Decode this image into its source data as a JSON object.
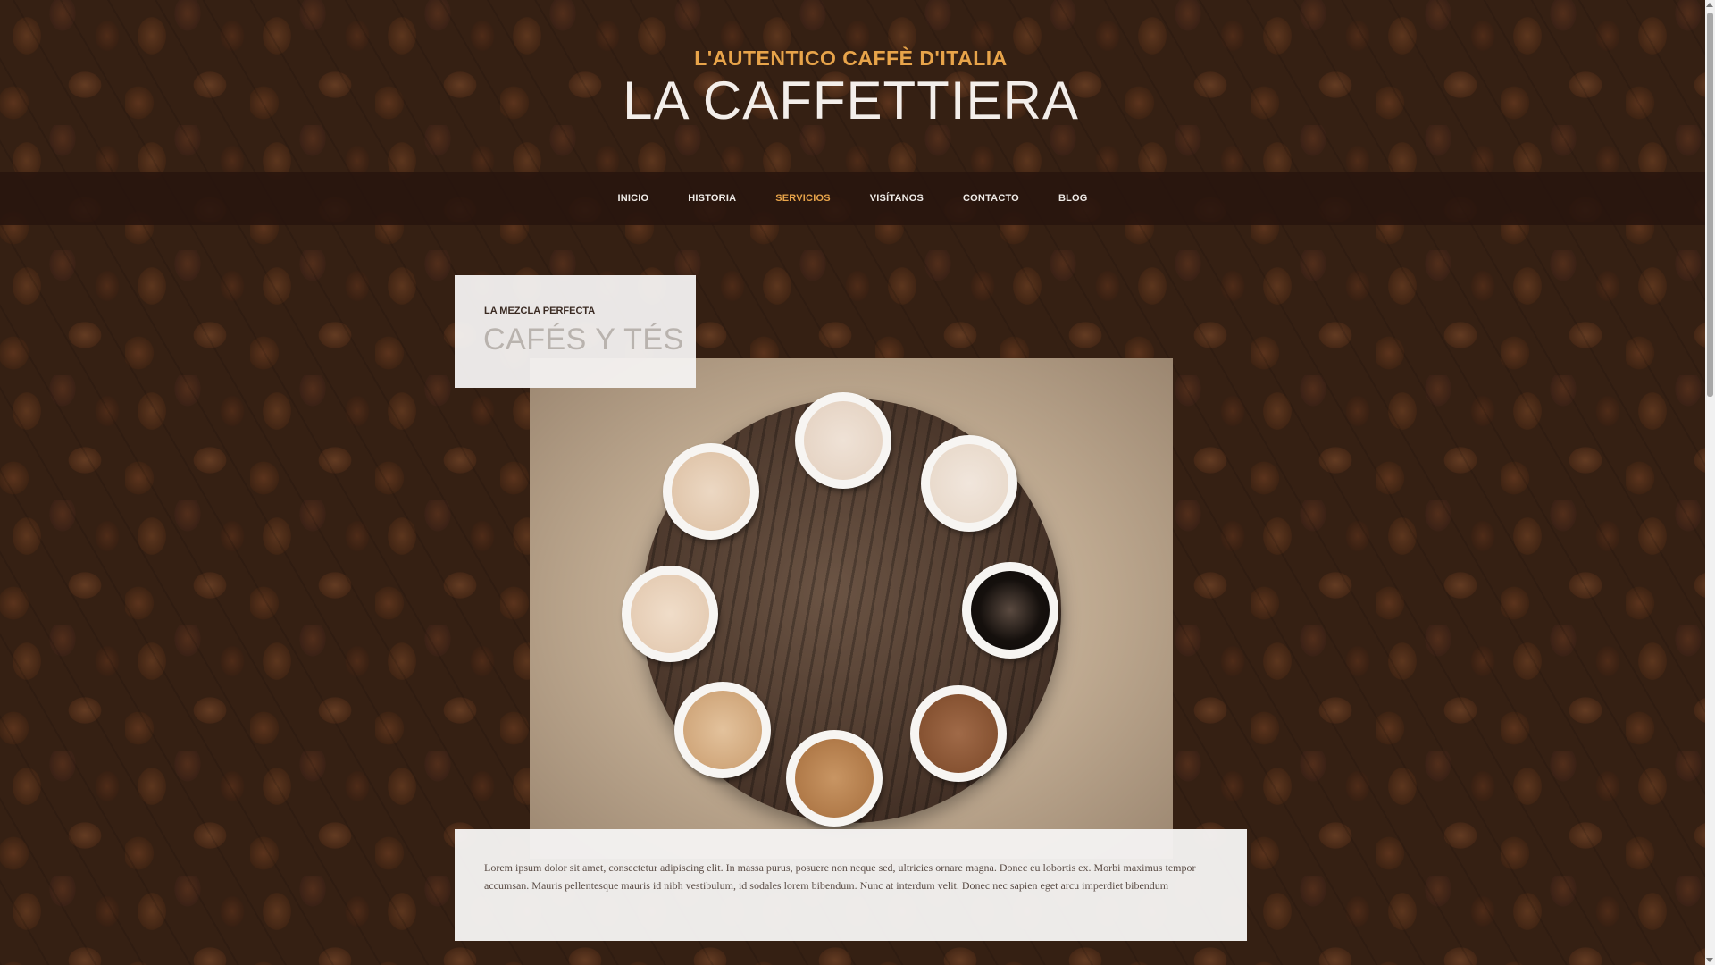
{
  "header": {
    "tagline": "L'AUTENTICO CAFFÈ D'ITALIA",
    "title": "LA CAFFETTIERA"
  },
  "nav": {
    "items": [
      {
        "label": "INICIO"
      },
      {
        "label": "HISTORIA"
      },
      {
        "label": "SERVICIOS",
        "active": true
      },
      {
        "label": "VISÍTANOS"
      },
      {
        "label": "CONTACTO"
      },
      {
        "label": "BLOG"
      }
    ]
  },
  "feature": {
    "eyebrow": "LA MEZCLA PERFECTA",
    "heading": "CAFÉS Y TÉS",
    "body": "Lorem ipsum dolor sit amet, consectetur adipiscing elit. In massa purus, posuere non neque sed, ultricies ornare magna. Donec eu lobortis ex. Morbi maximus tempor accumsan. Mauris pellentesque mauris id nibh vestibulum, id sodales lorem bibendum. Nunc at interdum velit. Donec nec sapien eget arcu imperdiet bibendum"
  },
  "colors": {
    "accent": "#e8a44a",
    "nav_bg": "#28140e",
    "card_bg": "#f4f2f1"
  }
}
